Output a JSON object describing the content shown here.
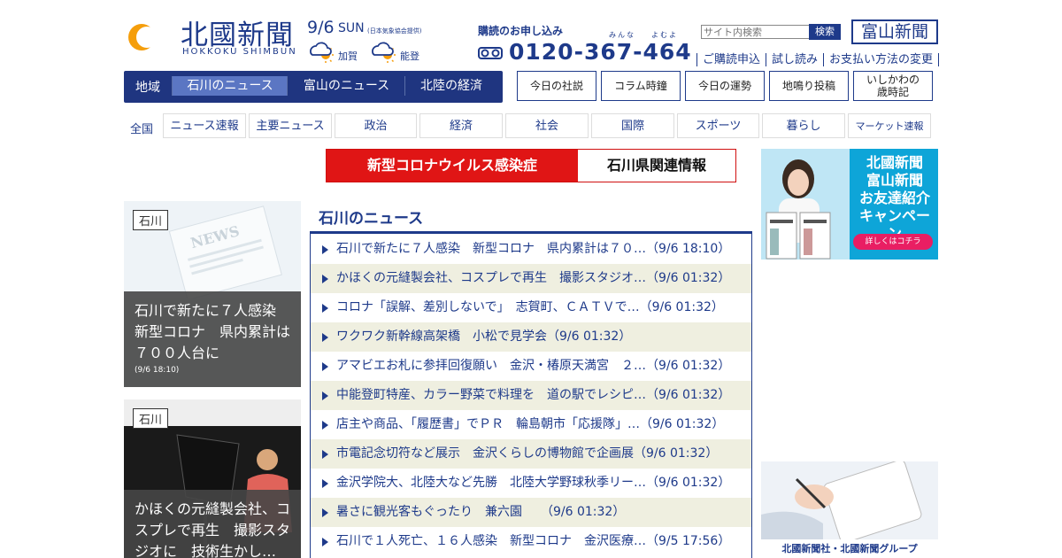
{
  "brand": {
    "title": "北國新聞",
    "subtitle": "HOKKOKU SHIMBUN",
    "colors": {
      "primary": "#1e3a8a",
      "accent_orange": "#f59e0b",
      "corona_red": "#e01515"
    }
  },
  "date": {
    "day": "9/6",
    "weekday": "SUN",
    "weather_source": "(日本気象協会提供)"
  },
  "weather": [
    {
      "icon": "cloud-sun-icon",
      "label": "加賀"
    },
    {
      "icon": "cloud-sun-icon",
      "label": "能登"
    }
  ],
  "subscription": {
    "title": "購読のお申し込み",
    "ruby": [
      "みんな",
      "よむよ"
    ],
    "icon": "freedial-icon",
    "phone": "0120-367-464"
  },
  "search": {
    "placeholder": "サイト内検索",
    "button": "検索"
  },
  "toyama_logo": "富山新聞",
  "top_links": [
    "ご購読申込",
    "試し読み",
    "お支払い方法の変更"
  ],
  "region_nav": {
    "label": "地域",
    "tabs": [
      {
        "label": "石川のニュース",
        "active": true
      },
      {
        "label": "富山のニュース",
        "active": false
      },
      {
        "label": "北陸の経済",
        "active": false
      }
    ]
  },
  "feature_buttons": [
    "今日の社説",
    "コラム時鐘",
    "今日の運勢",
    "地鳴り投稿",
    "いしかわの",
    "歳時記"
  ],
  "categories": {
    "label": "全国",
    "items": [
      "ニュース速報",
      "主要ニュース",
      "政治",
      "経済",
      "社会",
      "国際",
      "スポーツ",
      "暮らし",
      "マーケット速報"
    ]
  },
  "corona_banner": {
    "left": "新型コロナウイルス感染症",
    "right": "石川県関連情報"
  },
  "ad_top": {
    "lines": [
      "北國新聞",
      "富山新聞",
      "お友達紹介",
      "キャンペーン"
    ],
    "button": "詳しくはコチラ"
  },
  "ad_bottom": {
    "caption": "北國新聞社・北國新聞グループ"
  },
  "featured": [
    {
      "tag": "石川",
      "title": "石川で新たに７人感染　新型コロナ　県内累計は７００人台に",
      "date": "(9/6 18:10)",
      "image_word": "NEWS"
    },
    {
      "tag": "石川",
      "title": "かほくの元縫製会社、コスプレで再生　撮影スタジオに　技術生かし…",
      "date": ""
    }
  ],
  "news": {
    "heading": "石川のニュース",
    "items": [
      "石川で新たに７人感染　新型コロナ　県内累計は７０…（9/6 18:10）",
      "かほくの元縫製会社、コスプレで再生　撮影スタジオ…（9/6 01:32）",
      "コロナ「誤解、差別しないで」　志賀町、ＣＡＴＶで…（9/6 01:32）",
      "ワクワク新幹線高架橋　小松で見学会（9/6 01:32）",
      "アマビエお札に参拝回復願い　金沢・椿原天満宮　２…（9/6 01:32）",
      "中能登町特産、カラー野菜で料理を　道の駅でレシピ…（9/6 01:32）",
      "店主や商品、「履歴書」でＰＲ　輪島朝市「応援隊」…（9/6 01:32）",
      "市電記念切符など展示　金沢くらしの博物館で企画展（9/6 01:32）",
      "金沢学院大、北陸大など先勝　北陸大学野球秋季リー…（9/6 01:32）",
      "暑さに観光客もぐったり　兼六園　　（9/6 01:32）",
      "石川で１人死亡、１６人感染　新型コロナ　金沢医療…（9/5 17:56）"
    ]
  }
}
